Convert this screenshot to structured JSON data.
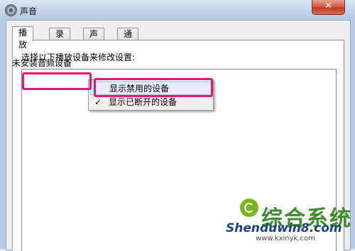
{
  "window": {
    "title": "声音",
    "close_label": "✕",
    "icon": "speaker-icon"
  },
  "tabs": [
    {
      "label": "播放",
      "active": true
    },
    {
      "label": "录制",
      "active": false
    },
    {
      "label": "声音",
      "active": false
    },
    {
      "label": "通信",
      "active": false
    }
  ],
  "panel": {
    "instruction": "选择以下播放设备来修改设置:",
    "empty_message": "未安装音频设备"
  },
  "context_menu": {
    "items": [
      {
        "label": "显示禁用的设备",
        "checked": false,
        "highlighted": true
      },
      {
        "label": "显示已断开的设备",
        "checked": true,
        "highlighted": false
      }
    ],
    "check_glyph": "✓"
  },
  "annotation_color": "#e0187a",
  "watermark": {
    "brand": "Shenduwin8.com",
    "url": "www.kxinyk.com",
    "logo_text": "综合系统"
  }
}
